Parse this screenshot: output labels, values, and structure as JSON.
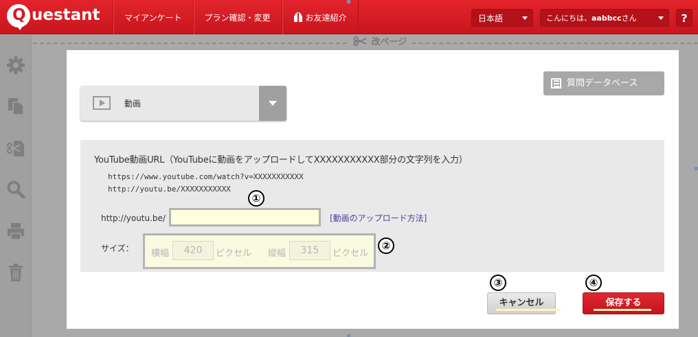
{
  "header": {
    "logo": "Questant",
    "nav": [
      "マイアンケート",
      "プラン確認・変更",
      "お友達紹介"
    ],
    "language": "日本語",
    "greeting_prefix": "こんにちは、",
    "username": "aabbcc",
    "greeting_suffix": "さん",
    "help": "?"
  },
  "page_break": {
    "label": "改ページ",
    "icon": "scissors-icon"
  },
  "sidebar": {
    "icons": [
      "gear-icon",
      "copy-icon",
      "cut-icon",
      "search-icon",
      "print-icon",
      "trash-icon"
    ]
  },
  "editor": {
    "question_type": "動画",
    "question_db_button": "質問データベース",
    "instructions": "YouTube動画URL（YouTubeに動画をアップロードしてXXXXXXXXXXX部分の文字列を入力）",
    "examples": [
      "https://www.youtube.com/watch?v=XXXXXXXXXXX",
      "http://youtu.be/XXXXXXXXXXX"
    ],
    "url_prefix": "http://youtu.be/",
    "url_value": "",
    "upload_link": "[動画のアップロード方法]",
    "size_label": "サイズ：",
    "width_label": "横幅",
    "width_value": "420",
    "height_label": "縦幅",
    "height_value": "315",
    "unit": "ピクセル",
    "cancel": "キャンセル",
    "save": "保存する"
  },
  "callouts": [
    "①",
    "②",
    "③",
    "④"
  ]
}
